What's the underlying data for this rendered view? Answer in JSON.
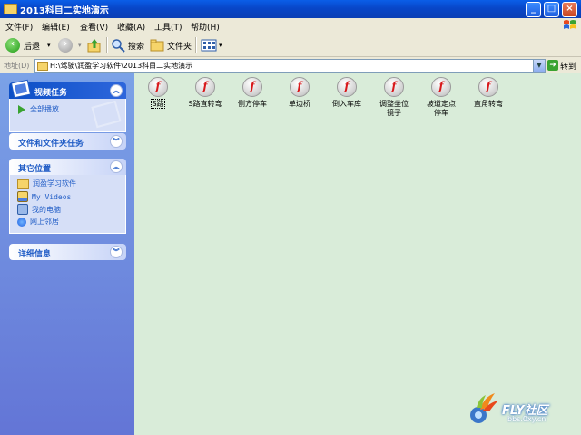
{
  "window": {
    "title": "2013科目二实地演示"
  },
  "menu": [
    "文件(F)",
    "编辑(E)",
    "查看(V)",
    "收藏(A)",
    "工具(T)",
    "帮助(H)"
  ],
  "toolbar": {
    "back": "后退",
    "search": "搜索",
    "folders": "文件夹"
  },
  "address": {
    "label": "地址(D)",
    "path": "H:\\驾驶\\润盈学习软件\\2013科目二实地演示",
    "go": "转到"
  },
  "sidebar": {
    "video_tasks": {
      "title": "视频任务",
      "items": [
        "全部播放"
      ]
    },
    "file_tasks": {
      "title": "文件和文件夹任务"
    },
    "other_places": {
      "title": "其它位置",
      "items": [
        "润盈学习软件",
        "My Videos",
        "我的电脑",
        "网上邻居"
      ]
    },
    "details": {
      "title": "详细信息"
    }
  },
  "files": [
    {
      "name": "S路"
    },
    {
      "name": "S路直转弯"
    },
    {
      "name": "侧方停车"
    },
    {
      "name": "单边桥"
    },
    {
      "name": "倒入车库"
    },
    {
      "name": "调整坐位镜子"
    },
    {
      "name": "坡道定点停车"
    },
    {
      "name": "直角转弯"
    }
  ],
  "watermark": {
    "brand": "FLY社区",
    "site": "bbs.0xy.cn"
  },
  "colors": {
    "titlebar": "#0a5ee8",
    "sidebar": "#6f8fe0",
    "content": "#d9ecd9",
    "flash": "#d8181b"
  }
}
